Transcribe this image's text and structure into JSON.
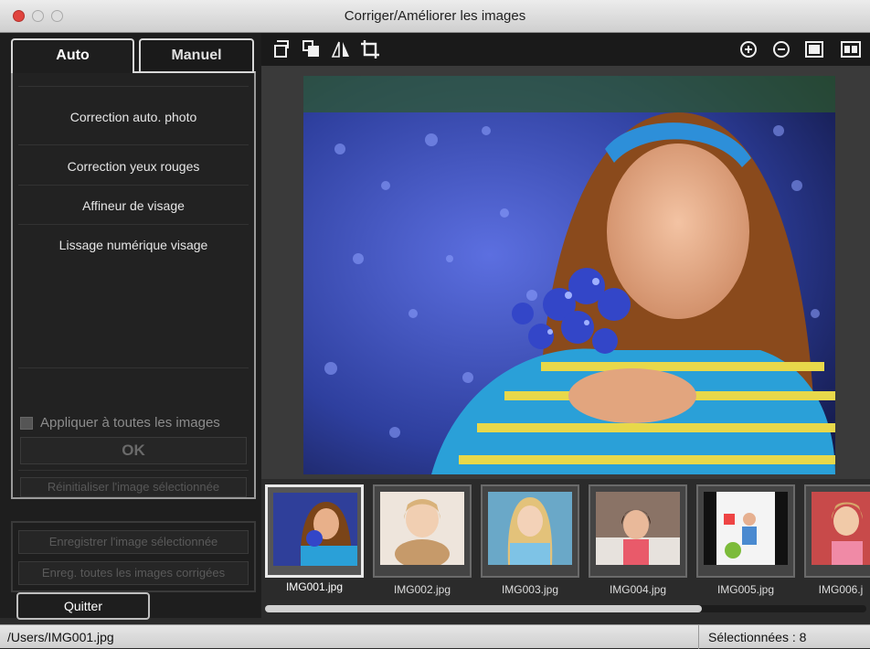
{
  "window": {
    "title": "Corriger/Améliorer les images"
  },
  "tabs": [
    {
      "label": "Auto"
    },
    {
      "label": "Manuel"
    }
  ],
  "corrections": [
    {
      "label": "Correction auto. photo"
    },
    {
      "label": "Correction yeux rouges"
    },
    {
      "label": "Affineur de visage"
    },
    {
      "label": "Lissage numérique visage"
    }
  ],
  "apply_all": {
    "label": "Appliquer à toutes les images",
    "checked": false
  },
  "ok_button": {
    "label": "OK"
  },
  "reset_button": {
    "label": "Réinitialiser l'image sélectionnée"
  },
  "save_selected": {
    "label": "Enregistrer l'image sélectionnée"
  },
  "save_all": {
    "label": "Enreg. toutes les images corrigées"
  },
  "quit_button": {
    "label": "Quitter"
  },
  "toolbar": {
    "left_icons": [
      "rotate-left-icon",
      "rotate-right-icon",
      "flip-horizontal-icon",
      "crop-icon"
    ],
    "right_icons": [
      "zoom-in-icon",
      "zoom-out-icon",
      "single-view-icon",
      "compare-view-icon"
    ]
  },
  "thumbnails": [
    {
      "name": "IMG001.jpg",
      "selected": true
    },
    {
      "name": "IMG002.jpg",
      "selected": false
    },
    {
      "name": "IMG003.jpg",
      "selected": false
    },
    {
      "name": "IMG004.jpg",
      "selected": false
    },
    {
      "name": "IMG005.jpg",
      "selected": false
    },
    {
      "name": "IMG006.j",
      "selected": false
    }
  ],
  "status": {
    "path": "/Users/IMG001.jpg",
    "selected_label": "Sélectionnées : 8"
  },
  "colors": {
    "close": "#e0443e",
    "panel_bg": "#1e1e1e",
    "toolbar_bg": "#1a1a1a"
  }
}
